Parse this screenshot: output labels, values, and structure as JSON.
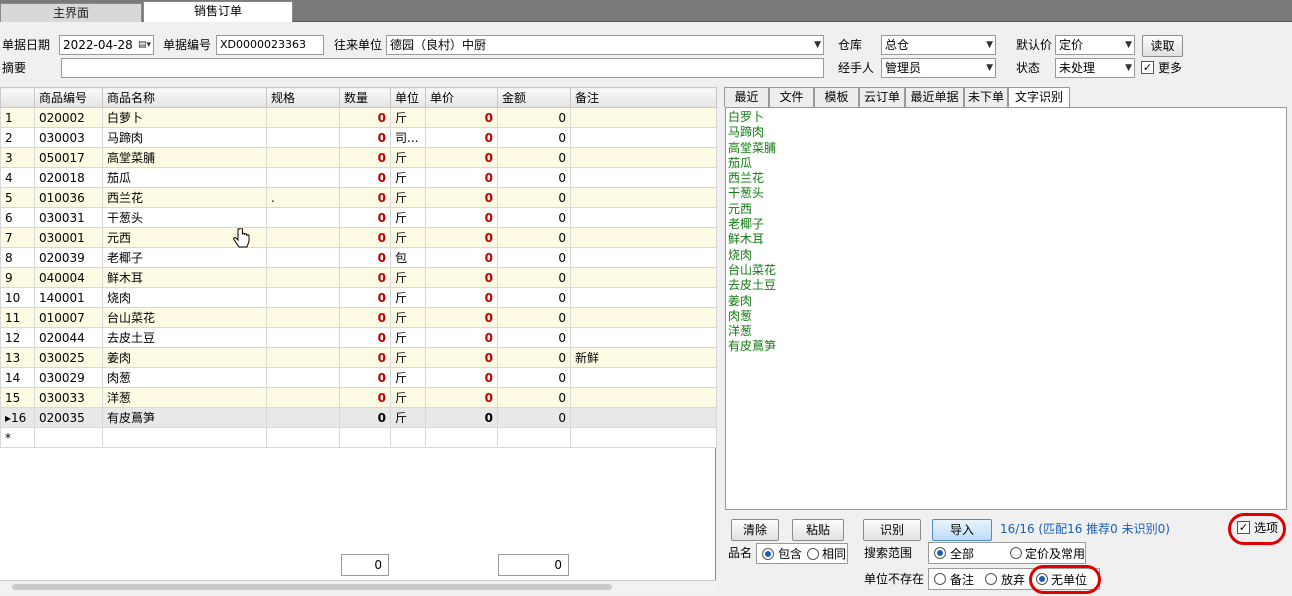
{
  "tabs": [
    {
      "label": "主界面"
    },
    {
      "label": "销售订单"
    }
  ],
  "form": {
    "date_label": "单据日期",
    "date_value": "2022-04-28",
    "no_label": "单据编号",
    "no_value": "XD0000023363",
    "partner_label": "往来单位",
    "partner_value": "德园（良村）中厨",
    "warehouse_label": "仓库",
    "warehouse_value": "总仓",
    "default_price_label": "默认价",
    "default_price_value": "定价",
    "read_button": "读取",
    "memo_label": "摘要",
    "memo_value": "",
    "handler_label": "经手人",
    "handler_value": "管理员",
    "status_label": "状态",
    "status_value": "未处理",
    "more_label": "更多",
    "more_checked": true
  },
  "grid": {
    "columns": [
      "商品编号",
      "商品名称",
      "规格",
      "数量",
      "单位",
      "单价",
      "金额",
      "备注"
    ],
    "rows": [
      {
        "n": "1",
        "code": "020002",
        "name": "白萝卜",
        "spec": "",
        "qty": "0",
        "unit": "斤",
        "price": "0",
        "amount": "0",
        "note": ""
      },
      {
        "n": "2",
        "code": "030003",
        "name": "马蹄肉",
        "spec": "",
        "qty": "0",
        "unit": "司...",
        "price": "0",
        "amount": "0",
        "note": ""
      },
      {
        "n": "3",
        "code": "050017",
        "name": "高堂菜脯",
        "spec": "",
        "qty": "0",
        "unit": "斤",
        "price": "0",
        "amount": "0",
        "note": ""
      },
      {
        "n": "4",
        "code": "020018",
        "name": "茄瓜",
        "spec": "",
        "qty": "0",
        "unit": "斤",
        "price": "0",
        "amount": "0",
        "note": ""
      },
      {
        "n": "5",
        "code": "010036",
        "name": "西兰花",
        "spec": ".",
        "qty": "0",
        "unit": "斤",
        "price": "0",
        "amount": "0",
        "note": ""
      },
      {
        "n": "6",
        "code": "030031",
        "name": "干葱头",
        "spec": "",
        "qty": "0",
        "unit": "斤",
        "price": "0",
        "amount": "0",
        "note": ""
      },
      {
        "n": "7",
        "code": "030001",
        "name": "元西",
        "spec": "",
        "qty": "0",
        "unit": "斤",
        "price": "0",
        "amount": "0",
        "note": ""
      },
      {
        "n": "8",
        "code": "020039",
        "name": "老椰子",
        "spec": "",
        "qty": "0",
        "unit": "包",
        "price": "0",
        "amount": "0",
        "note": ""
      },
      {
        "n": "9",
        "code": "040004",
        "name": "鲜木耳",
        "spec": "",
        "qty": "0",
        "unit": "斤",
        "price": "0",
        "amount": "0",
        "note": ""
      },
      {
        "n": "10",
        "code": "140001",
        "name": "烧肉",
        "spec": "",
        "qty": "0",
        "unit": "斤",
        "price": "0",
        "amount": "0",
        "note": ""
      },
      {
        "n": "11",
        "code": "010007",
        "name": "台山菜花",
        "spec": "",
        "qty": "0",
        "unit": "斤",
        "price": "0",
        "amount": "0",
        "note": ""
      },
      {
        "n": "12",
        "code": "020044",
        "name": "去皮土豆",
        "spec": "",
        "qty": "0",
        "unit": "斤",
        "price": "0",
        "amount": "0",
        "note": ""
      },
      {
        "n": "13",
        "code": "030025",
        "name": "姜肉",
        "spec": "",
        "qty": "0",
        "unit": "斤",
        "price": "0",
        "amount": "0",
        "note": "新鲜"
      },
      {
        "n": "14",
        "code": "030029",
        "name": "肉葱",
        "spec": "",
        "qty": "0",
        "unit": "斤",
        "price": "0",
        "amount": "0",
        "note": ""
      },
      {
        "n": "15",
        "code": "030033",
        "name": "洋葱",
        "spec": "",
        "qty": "0",
        "unit": "斤",
        "price": "0",
        "amount": "0",
        "note": ""
      },
      {
        "n": "16",
        "code": "020035",
        "name": "有皮蔦笋",
        "spec": "",
        "qty": "0",
        "unit": "斤",
        "price": "0",
        "amount": "0",
        "note": ""
      }
    ],
    "new_row_marker": "*",
    "current_marker": "▸",
    "sum_qty": "0",
    "sum_amount": "0"
  },
  "right": {
    "tabs": [
      "最近",
      "文件",
      "模板",
      "云订单",
      "最近单据",
      "未下单",
      "文字识别"
    ],
    "ocr_lines": [
      "白罗卜",
      "马蹄肉",
      "高堂菜脯",
      "茄瓜",
      "西兰花",
      "干葱头",
      "元西",
      "老椰子",
      "鲜木耳",
      "烧肉",
      "台山菜花",
      "去皮土豆",
      "姜肉",
      "肉葱",
      "洋葱",
      "有皮蔦笋"
    ],
    "buttons": {
      "clear": "清除",
      "paste": "粘贴",
      "recognize": "识别",
      "import": "导入"
    },
    "result": "16/16 (匹配16 推荐0 未识别0)",
    "options_label": "选项",
    "options_checked": true,
    "name_label": "品名",
    "name_opts": [
      "包含",
      "相同"
    ],
    "search_label": "搜索范围",
    "search_opts": [
      "全部",
      "定价及常用"
    ],
    "unit_label": "单位不存在",
    "unit_opts": [
      "备注",
      "放弃",
      "无单位"
    ],
    "colors": {
      "ocr_text": "#127a12",
      "highlight": "#e00000",
      "result_text": "#1a5fb4"
    }
  }
}
